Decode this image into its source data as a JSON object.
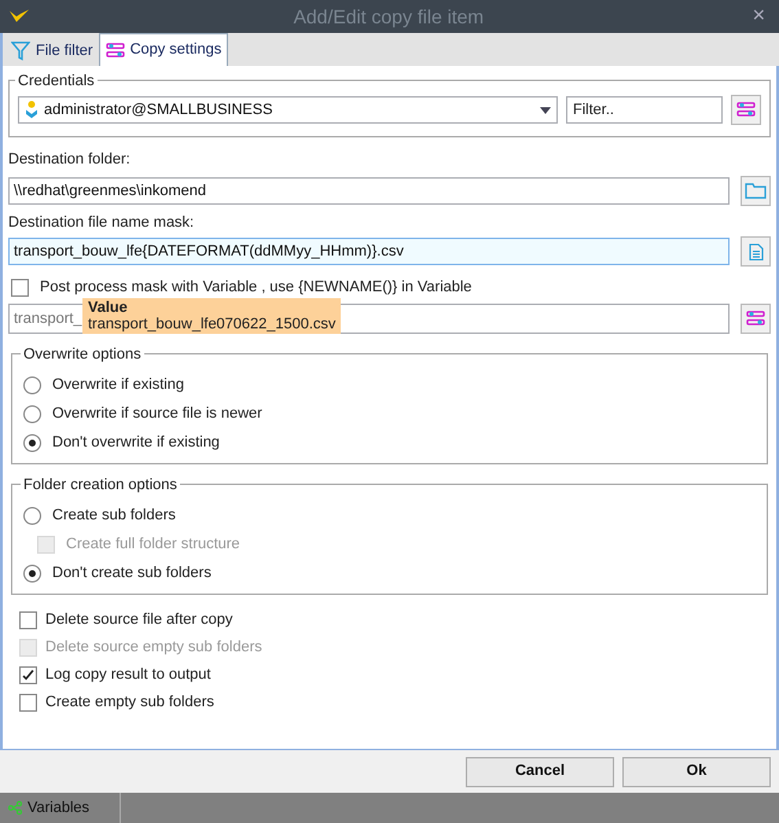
{
  "window": {
    "title": "Add/Edit copy file item",
    "close": "×"
  },
  "tabs": [
    {
      "label": "File filter",
      "selected": false
    },
    {
      "label": "Copy settings",
      "selected": true
    }
  ],
  "credentials": {
    "title": "Credentials",
    "account": "administrator@SMALLBUSINESS",
    "filter_placeholder": "Filter.."
  },
  "destination_folder": {
    "label": "Destination folder:",
    "value": "\\\\redhat\\greenmes\\inkomend"
  },
  "file_name_mask": {
    "label": "Destination file name mask:",
    "value": "transport_bouw_lfe{DATEFORMAT(ddMMyy_HHmm)}.csv"
  },
  "post_process": {
    "label": "Post process mask with Variable , use {NEWNAME()} in Variable",
    "checked": false,
    "preview": "transport_",
    "tooltip": {
      "title": "Value",
      "value": "transport_bouw_lfe070622_1500.csv"
    }
  },
  "overwrite_options": {
    "title": "Overwrite options",
    "items": [
      {
        "kind": "radio",
        "label": "Overwrite if existing",
        "selected": false,
        "disabled": false
      },
      {
        "kind": "radio",
        "label": "Overwrite if source file is newer",
        "selected": false,
        "disabled": false
      },
      {
        "kind": "radio",
        "label": "Don't overwrite if existing",
        "selected": true,
        "disabled": false
      }
    ]
  },
  "folder_creation_options": {
    "title": "Folder creation options",
    "items": [
      {
        "kind": "radio",
        "label": "Create sub folders",
        "selected": false,
        "disabled": false
      },
      {
        "kind": "checkbox",
        "label": "Create full folder structure",
        "checked": false,
        "disabled": true
      },
      {
        "kind": "radio",
        "label": "Don't create sub folders",
        "selected": true,
        "disabled": false
      }
    ]
  },
  "options": [
    {
      "label": "Delete source file after copy",
      "checked": false,
      "disabled": false
    },
    {
      "label": "Delete source empty sub folders",
      "checked": false,
      "disabled": true
    },
    {
      "label": "Log copy result to output",
      "checked": true,
      "disabled": false
    },
    {
      "label": "Create empty sub folders",
      "checked": false,
      "disabled": false
    }
  ],
  "buttons": [
    "Cancel",
    "Ok"
  ],
  "status_bar": {
    "label": "Variables"
  }
}
